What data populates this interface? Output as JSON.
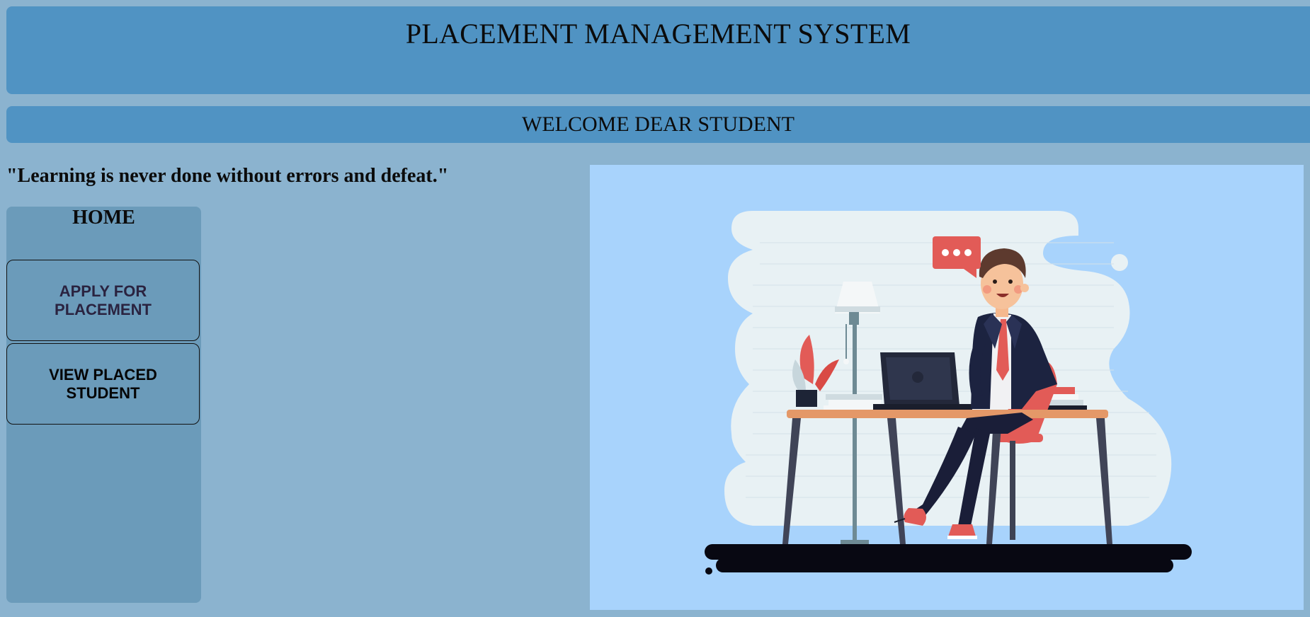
{
  "header": {
    "title": "PLACEMENT MANAGEMENT SYSTEM"
  },
  "welcome": {
    "text": "WELCOME DEAR STUDENT"
  },
  "quote": {
    "text": "\"Learning is never done without errors and defeat.\""
  },
  "sidebar": {
    "home_label": "HOME",
    "buttons": [
      {
        "label": "APPLY FOR PLACEMENT"
      },
      {
        "label": "VIEW PLACED STUDENT"
      }
    ]
  },
  "colors": {
    "page_background": "#8bb3cf",
    "header_background": "#5093c3",
    "sidebar_background": "#6b9bba",
    "illustration_background": "#a8d3fc"
  },
  "illustration": {
    "icon": "office-worker-at-desk-illustration"
  }
}
